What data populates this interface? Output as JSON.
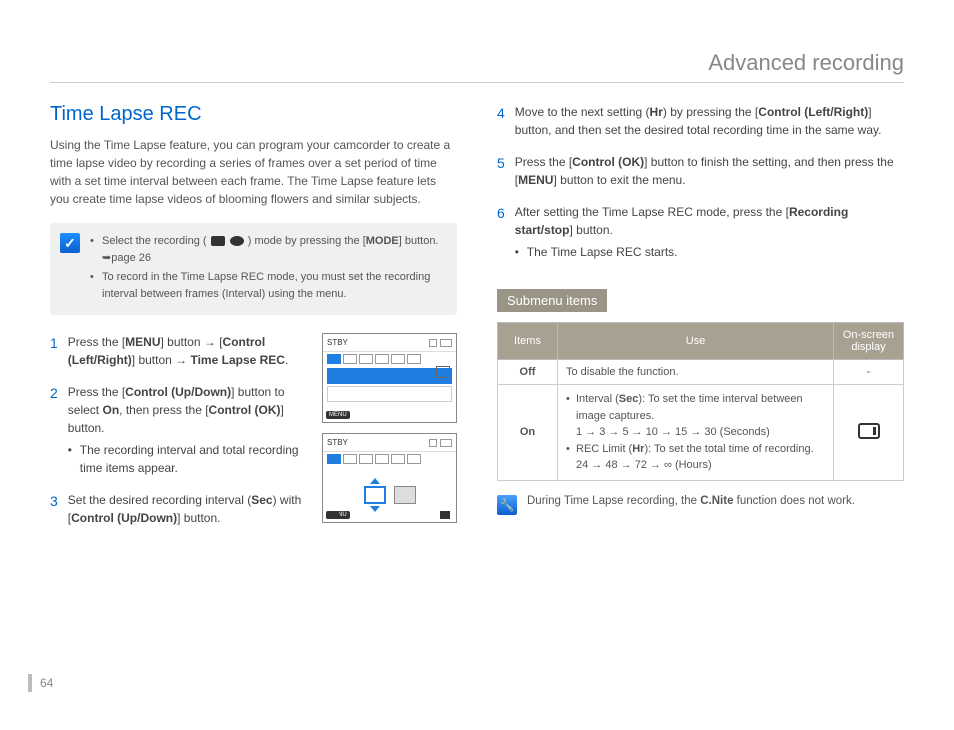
{
  "header": {
    "title": "Advanced recording"
  },
  "page_number": "64",
  "left": {
    "section_title": "Time Lapse REC",
    "intro": "Using the Time Lapse feature, you can program your camcorder to create a time lapse video by recording a series of frames over a set period of time with a set time interval between each frame. The Time Lapse feature lets you create time lapse videos of blooming flowers and similar subjects.",
    "infobox": {
      "items": [
        {
          "pre": "Select the recording ( ",
          "post": " ) mode by pressing the [",
          "bold": "MODE",
          "tail": "] button. ➥page 26"
        },
        {
          "text": "To record in the Time Lapse REC mode, you must set the recording interval between frames (Interval) using the menu."
        }
      ]
    },
    "steps": [
      {
        "n": "1",
        "body_html": "Press the [<b>MENU</b>] button → [<b>Control (Left/Right)</b>] button → <b>Time Lapse REC</b>."
      },
      {
        "n": "2",
        "body_html": "Press the [<b>Control (Up/Down)</b>] button to select <b>On</b>, then press the [<b>Control (OK)</b>] button.",
        "sub": "The recording interval and total recording time items appear."
      },
      {
        "n": "3",
        "body_html": "Set the desired recording interval (<b>Sec</b>) with [<b>Control (Up/Down)</b>] button."
      }
    ]
  },
  "right": {
    "steps": [
      {
        "n": "4",
        "body_html": "Move to the next setting (<b>Hr</b>) by pressing the [<b>Control (Left/Right)</b>] button, and then set the desired total recording time in the same way."
      },
      {
        "n": "5",
        "body_html": "Press the [<b>Control (OK)</b>] button to finish the setting, and then press the [<b>MENU</b>] button to exit the menu."
      },
      {
        "n": "6",
        "body_html": "After setting the Time Lapse REC mode, press the [<b>Recording start/stop</b>] button.",
        "sub": "The Time Lapse REC starts."
      }
    ],
    "subhead": "Submenu items",
    "table": {
      "headers": [
        "Items",
        "Use",
        "On-screen display"
      ],
      "rows": [
        {
          "item": "Off",
          "use_text": "To disable the function.",
          "display": "-"
        },
        {
          "item": "On",
          "use_list": [
            "Interval (<b>Sec</b>): To set the time interval between image captures.<br>1 → 3 → 5 → 10 → 15 → 30 (Seconds)",
            "REC Limit (<b>Hr</b>): To set the total time of recording.<br>24 → 48 → 72 → ∞ (Hours)"
          ],
          "display_icon": true
        }
      ]
    },
    "note_html": "During Time Lapse recording, the <b>C.Nite</b> function does not work."
  }
}
